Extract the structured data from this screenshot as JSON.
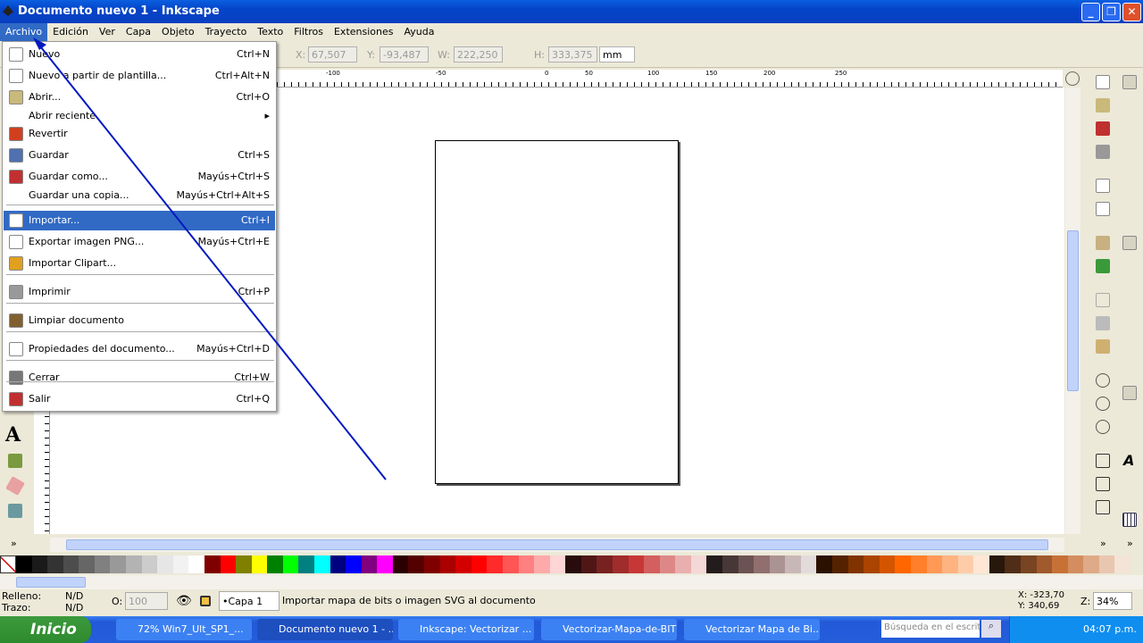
{
  "window": {
    "title": "Documento nuevo 1 - Inkscape",
    "min": "_",
    "max": "❐",
    "close": "✕"
  },
  "menubar": [
    "Archivo",
    "Edición",
    "Ver",
    "Capa",
    "Objeto",
    "Trayecto",
    "Texto",
    "Filtros",
    "Extensiones",
    "Ayuda"
  ],
  "toolbar": {
    "x_label": "X:",
    "x": "67,507",
    "y_label": "Y:",
    "y": "-93,487",
    "w_label": "W:",
    "w": "222,250",
    "h_label": "H:",
    "h": "333,375",
    "unit": "mm"
  },
  "ruler_ticks": [
    "-100",
    "-50",
    "0",
    "50",
    "100",
    "150",
    "200",
    "250"
  ],
  "file_menu": [
    {
      "label": "Nuevo",
      "shortcut": "Ctrl+N",
      "icon": "new-document-icon",
      "color": "#ffffff"
    },
    {
      "label": "Nuevo a partir de plantilla...",
      "shortcut": "Ctrl+Alt+N",
      "icon": "template-icon",
      "color": "#ffffff"
    },
    {
      "label": "Abrir...",
      "shortcut": "Ctrl+O",
      "icon": "open-folder-icon",
      "color": "#c9b97a"
    },
    {
      "label": "Abrir reciente",
      "shortcut": "▸",
      "icon": "",
      "color": ""
    },
    {
      "label": "Revertir",
      "shortcut": "",
      "icon": "revert-icon",
      "color": "#d04020"
    },
    {
      "label": "Guardar",
      "shortcut": "Ctrl+S",
      "icon": "save-icon",
      "color": "#5070b0"
    },
    {
      "label": "Guardar como...",
      "shortcut": "Mayús+Ctrl+S",
      "icon": "save-as-icon",
      "color": "#c03030"
    },
    {
      "label": "Guardar una copia...",
      "shortcut": "Mayús+Ctrl+Alt+S",
      "icon": "",
      "color": ""
    },
    {
      "label": "Importar...",
      "shortcut": "Ctrl+I",
      "icon": "import-icon",
      "color": "#ffffff"
    },
    {
      "label": "Exportar imagen PNG...",
      "shortcut": "Mayús+Ctrl+E",
      "icon": "export-png-icon",
      "color": "#ffffff"
    },
    {
      "label": "Importar Clipart...",
      "shortcut": "",
      "icon": "clipart-icon",
      "color": "#e0a020"
    },
    {
      "label": "Imprimir",
      "shortcut": "Ctrl+P",
      "icon": "print-icon",
      "color": "#999999"
    },
    {
      "label": "Limpiar documento",
      "shortcut": "",
      "icon": "vacuum-icon",
      "color": "#806030"
    },
    {
      "label": "Propiedades del documento...",
      "shortcut": "Mayús+Ctrl+D",
      "icon": "document-properties-icon",
      "color": "#ffffff"
    },
    {
      "label": "Cerrar",
      "shortcut": "Ctrl+W",
      "icon": "close-icon",
      "color": "#777777"
    },
    {
      "label": "Salir",
      "shortcut": "Ctrl+Q",
      "icon": "quit-icon",
      "color": "#c03030"
    }
  ],
  "palette": [
    "#000000",
    "#1a1a1a",
    "#333333",
    "#4d4d4d",
    "#666666",
    "#808080",
    "#999999",
    "#b3b3b3",
    "#cccccc",
    "#e6e6e6",
    "#f2f2f2",
    "#ffffff",
    "#800000",
    "#ff0000",
    "#808000",
    "#ffff00",
    "#008000",
    "#00ff00",
    "#008080",
    "#00ffff",
    "#000080",
    "#0000ff",
    "#800080",
    "#ff00ff",
    "#2b0000",
    "#550000",
    "#800000",
    "#aa0000",
    "#d40000",
    "#ff0000",
    "#ff2a2a",
    "#ff5555",
    "#ff8080",
    "#ffaaaa",
    "#ffd5d5",
    "#280b0b",
    "#501616",
    "#782121",
    "#a02c2c",
    "#c83737",
    "#d35f5f",
    "#de8787",
    "#e9afaf",
    "#f4d7d7",
    "#241c1c",
    "#483737",
    "#6c5353",
    "#916f6f",
    "#ac9393",
    "#c8b7b7",
    "#e3dbdb",
    "#2b1100",
    "#552200",
    "#803300",
    "#aa4400",
    "#d45500",
    "#ff6600",
    "#ff7f2a",
    "#ff9955",
    "#ffb380",
    "#ffccaa",
    "#ffe6d5",
    "#28170b",
    "#502d16",
    "#784421",
    "#a05a2c",
    "#c87137",
    "#d38d5f",
    "#deaa87",
    "#e9c6af",
    "#f4e3d7"
  ],
  "status": {
    "fill_label": "Relleno:",
    "fill": "N/D",
    "stroke_label": "Trazo:",
    "stroke": "N/D",
    "opacity_label": "O:",
    "opacity": "100",
    "layer": "•Capa 1",
    "message": "Importar mapa de bits o imagen SVG al documento",
    "cursor_x": "X: -323,70",
    "cursor_y": "Y:  340,69",
    "zoom_label": "Z:",
    "zoom": "34%"
  },
  "taskbar": {
    "start": "Inicio",
    "tasks": [
      "72% Win7_Ult_SP1_...",
      "Documento nuevo 1 - ...",
      "Inkscape: Vectorizar ...",
      "Vectorizar-Mapa-de-BIT",
      "Vectorizar Mapa de Bi..."
    ],
    "search_placeholder": "Búsqueda en el escrit",
    "clock": "04:07 p.m."
  },
  "misc": {
    "expand": "»"
  }
}
